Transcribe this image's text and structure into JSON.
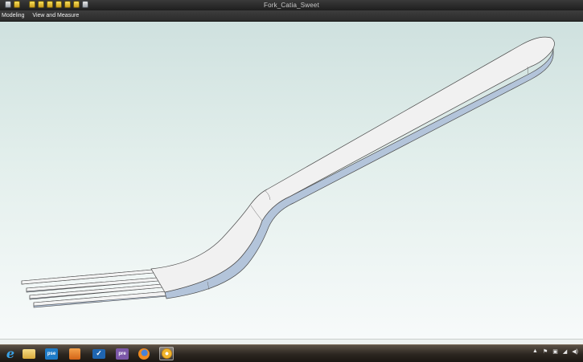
{
  "window": {
    "title": "Fork_Catia_Sweet"
  },
  "quick_access": {
    "icons": [
      "save-icon",
      "open-icon",
      "print-icon",
      "undo-icon",
      "redo-icon",
      "copy-icon",
      "paste-icon"
    ]
  },
  "menu": {
    "items": [
      "Modeling",
      "View and Measure"
    ]
  },
  "viewport": {
    "model": "fork",
    "colors": {
      "body": "#f2f2f2",
      "edge": "#b5c6dc",
      "outline": "#4a4a4a"
    }
  },
  "taskbar": {
    "apps": [
      {
        "icon": "internet-explorer-icon",
        "label": "e"
      },
      {
        "icon": "file-explorer-icon",
        "label": ""
      },
      {
        "icon": "photoshop-elements-icon",
        "label": "pse"
      },
      {
        "icon": "media-player-icon",
        "label": ""
      },
      {
        "icon": "checkmark-app-icon",
        "label": ""
      },
      {
        "icon": "premiere-elements-icon",
        "label": "pre"
      },
      {
        "icon": "firefox-icon",
        "label": ""
      },
      {
        "icon": "settings-app-icon",
        "label": ""
      }
    ],
    "tray_icons": [
      "show-hidden-icons-icon",
      "flag-icon",
      "network-icon",
      "signal-icon",
      "volume-icon"
    ]
  }
}
